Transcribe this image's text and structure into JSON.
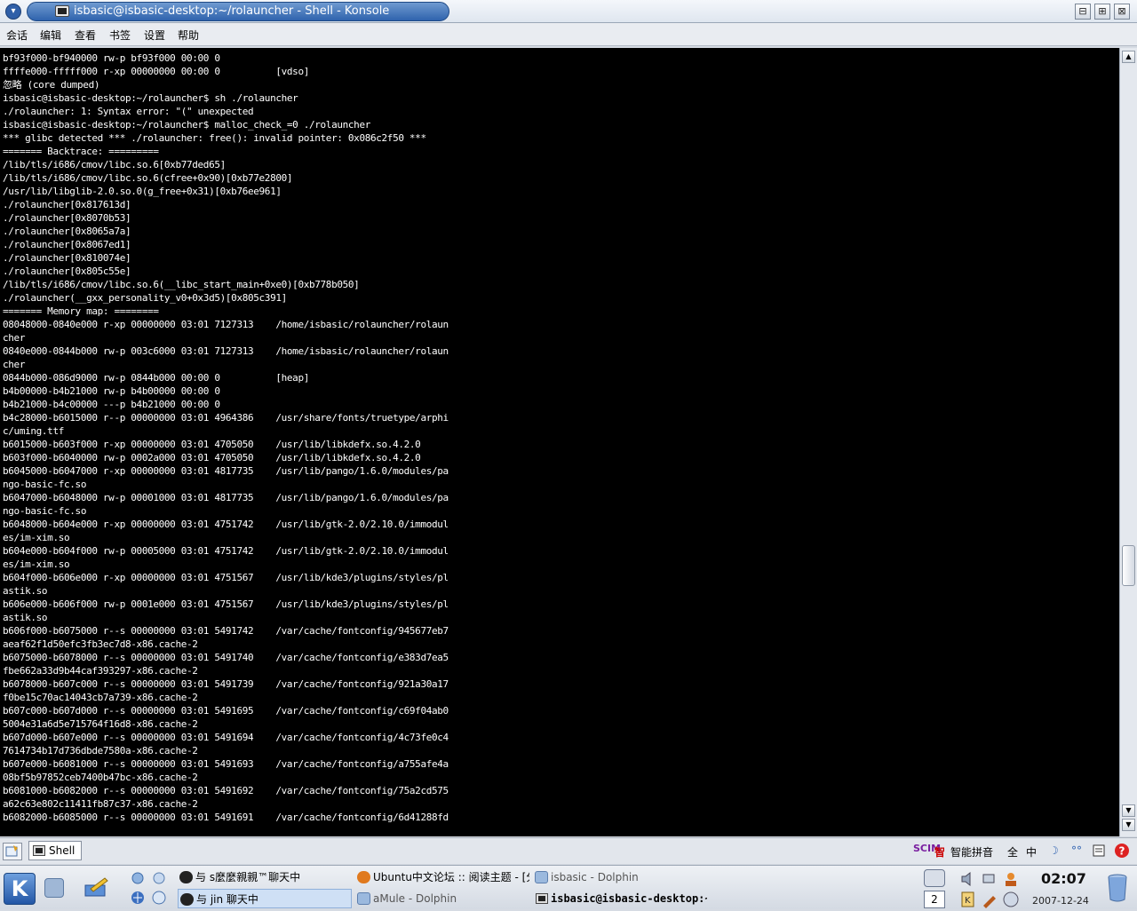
{
  "window": {
    "title": "isbasic@isbasic-desktop:~/rolauncher - Shell - Konsole",
    "minimize_symbol": "⊟",
    "maximize_symbol": "⊞",
    "close_symbol": "⊠"
  },
  "menubar": {
    "items": [
      "会话",
      "编辑",
      "查看",
      "书签",
      "设置",
      "帮助"
    ]
  },
  "terminal": {
    "lines": [
      "bf93f000-bf940000 rw-p bf93f000 00:00 0",
      "ffffe000-fffff000 r-xp 00000000 00:00 0          [vdso]",
      "忽略 (core dumped)",
      "isbasic@isbasic-desktop:~/rolauncher$ sh ./rolauncher",
      "./rolauncher: 1: Syntax error: \"(\" unexpected",
      "isbasic@isbasic-desktop:~/rolauncher$ malloc_check_=0 ./rolauncher",
      "*** glibc detected *** ./rolauncher: free(): invalid pointer: 0x086c2f50 ***",
      "======= Backtrace: =========",
      "/lib/tls/i686/cmov/libc.so.6[0xb77ded65]",
      "/lib/tls/i686/cmov/libc.so.6(cfree+0x90)[0xb77e2800]",
      "/usr/lib/libglib-2.0.so.0(g_free+0x31)[0xb76ee961]",
      "./rolauncher[0x817613d]",
      "./rolauncher[0x8070b53]",
      "./rolauncher[0x8065a7a]",
      "./rolauncher[0x8067ed1]",
      "./rolauncher[0x810074e]",
      "./rolauncher[0x805c55e]",
      "/lib/tls/i686/cmov/libc.so.6(__libc_start_main+0xe0)[0xb778b050]",
      "./rolauncher(__gxx_personality_v0+0x3d5)[0x805c391]",
      "======= Memory map: ========",
      "08048000-0840e000 r-xp 00000000 03:01 7127313    /home/isbasic/rolauncher/rolaun",
      "cher",
      "0840e000-0844b000 rw-p 003c6000 03:01 7127313    /home/isbasic/rolauncher/rolaun",
      "cher",
      "0844b000-086d9000 rw-p 0844b000 00:00 0          [heap]",
      "b4b00000-b4b21000 rw-p b4b00000 00:00 0",
      "b4b21000-b4c00000 ---p b4b21000 00:00 0",
      "b4c28000-b6015000 r--p 00000000 03:01 4964386    /usr/share/fonts/truetype/arphi",
      "c/uming.ttf",
      "b6015000-b603f000 r-xp 00000000 03:01 4705050    /usr/lib/libkdefx.so.4.2.0",
      "b603f000-b6040000 rw-p 0002a000 03:01 4705050    /usr/lib/libkdefx.so.4.2.0",
      "b6045000-b6047000 r-xp 00000000 03:01 4817735    /usr/lib/pango/1.6.0/modules/pa",
      "ngo-basic-fc.so",
      "b6047000-b6048000 rw-p 00001000 03:01 4817735    /usr/lib/pango/1.6.0/modules/pa",
      "ngo-basic-fc.so",
      "b6048000-b604e000 r-xp 00000000 03:01 4751742    /usr/lib/gtk-2.0/2.10.0/immodul",
      "es/im-xim.so",
      "b604e000-b604f000 rw-p 00005000 03:01 4751742    /usr/lib/gtk-2.0/2.10.0/immodul",
      "es/im-xim.so",
      "b604f000-b606e000 r-xp 00000000 03:01 4751567    /usr/lib/kde3/plugins/styles/pl",
      "astik.so",
      "b606e000-b606f000 rw-p 0001e000 03:01 4751567    /usr/lib/kde3/plugins/styles/pl",
      "astik.so",
      "b606f000-b6075000 r--s 00000000 03:01 5491742    /var/cache/fontconfig/945677eb7",
      "aeaf62f1d50efc3fb3ec7d8-x86.cache-2",
      "b6075000-b6078000 r--s 00000000 03:01 5491740    /var/cache/fontconfig/e383d7ea5",
      "fbe662a33d9b44caf393297-x86.cache-2",
      "b6078000-b607c000 r--s 00000000 03:01 5491739    /var/cache/fontconfig/921a30a17",
      "f0be15c70ac14043cb7a739-x86.cache-2",
      "b607c000-b607d000 r--s 00000000 03:01 5491695    /var/cache/fontconfig/c69f04ab0",
      "5004e31a6d5e715764f16d8-x86.cache-2",
      "b607d000-b607e000 r--s 00000000 03:01 5491694    /var/cache/fontconfig/4c73fe0c4",
      "7614734b17d736dbde7580a-x86.cache-2",
      "b607e000-b6081000 r--s 00000000 03:01 5491693    /var/cache/fontconfig/a755afe4a",
      "08bf5b97852ceb7400b47bc-x86.cache-2",
      "b6081000-b6082000 r--s 00000000 03:01 5491692    /var/cache/fontconfig/75a2cd575",
      "a62c63e802c11411fb87c37-x86.cache-2",
      "b6082000-b6085000 r--s 00000000 03:01 5491691    /var/cache/fontconfig/6d41288fd"
    ]
  },
  "konsole_tabs": {
    "tabs": [
      {
        "label": "Shell"
      }
    ]
  },
  "ime_bar": {
    "logo": "SCIM",
    "input_method": "智能拼音",
    "full_width": "全",
    "chinese": "中",
    "moon": "☽",
    "quote": "°°"
  },
  "taskbar": {
    "tasks_row1": [
      {
        "label": "与 s麼麼親親™聊天中"
      },
      {
        "label": "Ubuntu中文论坛 :: 阅读主题 - [分"
      },
      {
        "label": "isbasic - Dolphin"
      }
    ],
    "tasks_row2": [
      {
        "label": "与 jin 聊天中"
      },
      {
        "label": "aMule - Dolphin"
      },
      {
        "label": "isbasic@isbasic-desktop:~"
      }
    ],
    "desktop_number": "2",
    "clock_time": "02:07",
    "clock_date": "2007-12-24"
  },
  "colors": {
    "title_accent": "#2f63ad",
    "terminal_bg": "#000000",
    "terminal_fg": "#ffffff",
    "panel_bg": "#dfe4eb"
  }
}
